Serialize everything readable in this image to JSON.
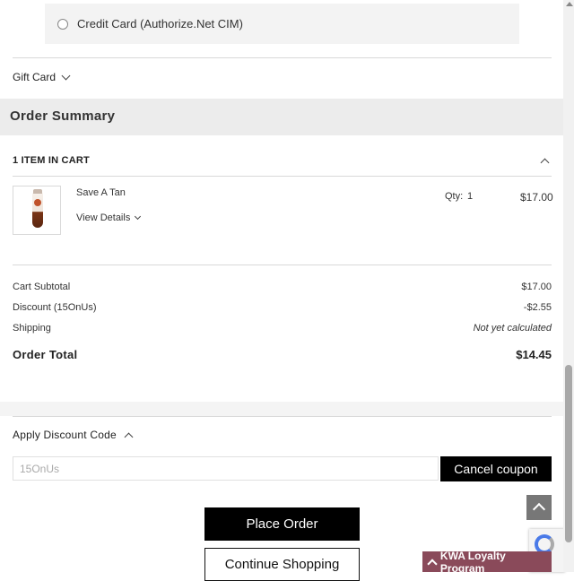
{
  "payment": {
    "option_label": "Credit Card (Authorize.Net CIM)"
  },
  "gift_card": {
    "label": "Gift Card"
  },
  "summary": {
    "title": "Order Summary",
    "items_in_cart": "1 Item in Cart",
    "item": {
      "name": "Save A Tan",
      "view_details": "View Details",
      "qty_label": "Qty:",
      "qty": "1",
      "price": "$17.00"
    },
    "totals": {
      "subtotal_label": "Cart Subtotal",
      "subtotal_value": "$17.00",
      "discount_label": "Discount (15OnUs)",
      "discount_value": "-$2.55",
      "shipping_label": "Shipping",
      "shipping_value": "Not yet calculated",
      "order_total_label": "Order Total",
      "order_total_value": "$14.45"
    }
  },
  "discount": {
    "title": "Apply Discount Code",
    "code_value": "15OnUs",
    "cancel_label": "Cancel coupon"
  },
  "actions": {
    "place_order": "Place Order",
    "continue_shopping": "Continue Shopping"
  },
  "loyalty": {
    "label": "KWA Loyalty Program"
  },
  "colors": {
    "button_black": "#000000",
    "loyalty_bg": "#8a4a5a",
    "summary_bar": "#ececec"
  }
}
